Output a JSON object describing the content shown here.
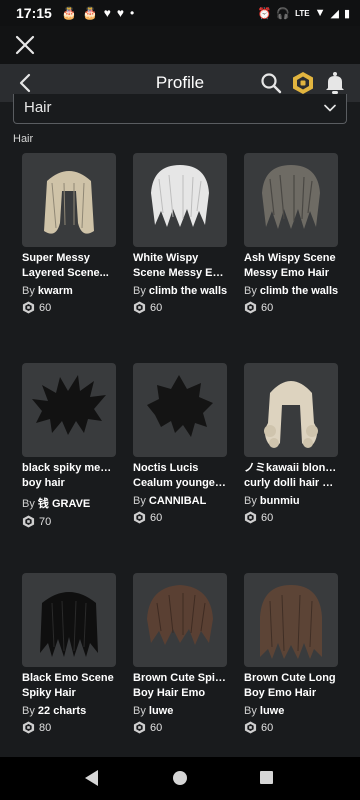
{
  "status_bar": {
    "time": "17:15",
    "left_icons": [
      "cake-icon",
      "cake-icon",
      "heart-icon",
      "heart-icon",
      "dot-icon"
    ],
    "network_label": "LTE"
  },
  "header": {
    "title": "Profile"
  },
  "dropdown": {
    "selected": "Hair"
  },
  "section_label": "Hair",
  "items": [
    {
      "name_line1": "Super Messy",
      "name_line2": "Layered Scene...",
      "by": "By",
      "creator": "kwarm",
      "price": "60",
      "hair_color": "#cfc3a8"
    },
    {
      "name_line1": "White Wispy",
      "name_line2": "Scene Messy Em...",
      "by": "By",
      "creator": "climb the walls",
      "price": "60",
      "hair_color": "#e6e6e6"
    },
    {
      "name_line1": "Ash Wispy Scene",
      "name_line2": "Messy Emo Hair",
      "by": "By",
      "creator": "climb the walls",
      "price": "60",
      "hair_color": "#6e6b64"
    },
    {
      "name_line1": "black spiky messy",
      "name_line2": "boy hair",
      "by": "By",
      "creator": "钱 GRAVE",
      "price": "70",
      "hair_color": "#121212"
    },
    {
      "name_line1": "Noctis Lucis",
      "name_line2": "Cealum younger...",
      "by": "By",
      "creator": "CANNIBAL",
      "price": "60",
      "hair_color": "#141414"
    },
    {
      "name_line1": "ノミkawaii blonde",
      "name_line2": "curly dolli hair ❤...",
      "by": "By",
      "creator": "bunmiu",
      "price": "60",
      "hair_color": "#ddd3bf"
    },
    {
      "name_line1": "Black Emo Scene",
      "name_line2": "Spiky Hair",
      "by": "By",
      "creator": "22 charts",
      "price": "80",
      "hair_color": "#0f0f0f"
    },
    {
      "name_line1": "Brown Cute Spiky",
      "name_line2": "Boy Hair Emo",
      "by": "By",
      "creator": "luwe",
      "price": "60",
      "hair_color": "#5a4033"
    },
    {
      "name_line1": "Brown Cute Long",
      "name_line2": "Boy Emo Hair",
      "by": "By",
      "creator": "luwe",
      "price": "60",
      "hair_color": "#5c4436"
    }
  ],
  "colors": {
    "background": "#191b1d",
    "header": "#2b2d30",
    "card_thumb": "#393b3d",
    "accent_robux": "#e2b53f"
  }
}
